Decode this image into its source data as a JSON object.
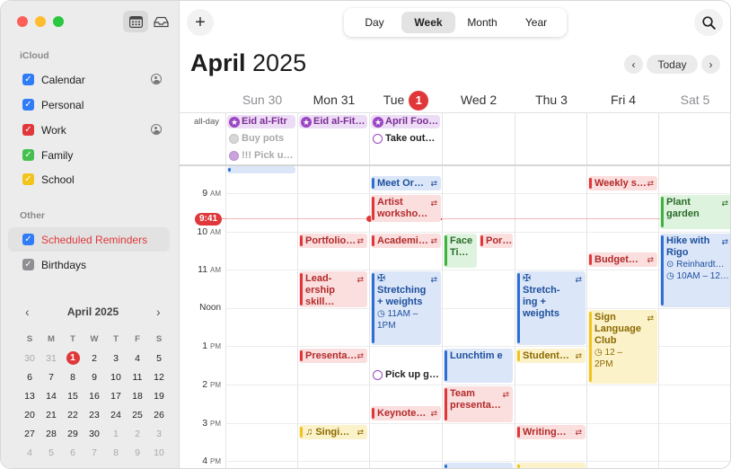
{
  "sidebar": {
    "icloud_header": "iCloud",
    "other_header": "Other",
    "calendars": [
      {
        "label": "Calendar",
        "color": "#2f7cf6",
        "shared": true
      },
      {
        "label": "Personal",
        "color": "#2f7cf6",
        "shared": false
      },
      {
        "label": "Work",
        "color": "#e0383a",
        "shared": true
      },
      {
        "label": "Family",
        "color": "#43c04d",
        "shared": false
      },
      {
        "label": "School",
        "color": "#f2c31b",
        "shared": false
      }
    ],
    "other": [
      {
        "label": "Scheduled Reminders",
        "color": "#2f7cf6"
      },
      {
        "label": "Birthdays",
        "color": "#8e8e93"
      }
    ]
  },
  "mini_calendar": {
    "title": "April 2025",
    "weekdays": [
      "S",
      "M",
      "T",
      "W",
      "T",
      "F",
      "S"
    ],
    "weeks": [
      [
        "30",
        "31",
        "1",
        "2",
        "3",
        "4",
        "5"
      ],
      [
        "6",
        "7",
        "8",
        "9",
        "10",
        "11",
        "12"
      ],
      [
        "13",
        "14",
        "15",
        "16",
        "17",
        "18",
        "19"
      ],
      [
        "20",
        "21",
        "22",
        "23",
        "24",
        "25",
        "26"
      ],
      [
        "27",
        "28",
        "29",
        "30",
        "1",
        "2",
        "3"
      ],
      [
        "4",
        "5",
        "6",
        "7",
        "8",
        "9",
        "10"
      ]
    ],
    "today": "1"
  },
  "toolbar": {
    "add": "+",
    "views": [
      "Day",
      "Week",
      "Month",
      "Year"
    ],
    "active_view": "Week"
  },
  "header": {
    "month": "April",
    "year": "2025",
    "today_button": "Today",
    "prev": "‹",
    "next": "›"
  },
  "days": [
    {
      "label": "Sun 30",
      "dim": true
    },
    {
      "label": "Mon 31",
      "dim": false
    },
    {
      "label": "Tue",
      "badge": "1",
      "dim": false
    },
    {
      "label": "Wed 2",
      "dim": false
    },
    {
      "label": "Thu 3",
      "dim": false
    },
    {
      "label": "Fri 4",
      "dim": false
    },
    {
      "label": "Sat 5",
      "dim": true
    }
  ],
  "allday_label": "all-day",
  "hours": [
    {
      "num": "9",
      "ampm": "AM"
    },
    {
      "num": "10",
      "ampm": "AM"
    },
    {
      "num": "11",
      "ampm": "AM"
    },
    {
      "num": "Noon",
      "ampm": ""
    },
    {
      "num": "1",
      "ampm": "PM"
    },
    {
      "num": "2",
      "ampm": "PM"
    },
    {
      "num": "3",
      "ampm": "PM"
    },
    {
      "num": "4",
      "ampm": "PM"
    }
  ],
  "current_time": "9:41",
  "allday_events": [
    {
      "title": "Eid al-Fitr",
      "icon": "★"
    },
    {
      "title": "Eid al-Fit…",
      "icon": "★"
    },
    {
      "title": "April Foo…",
      "icon": "★"
    }
  ],
  "reminders": [
    {
      "title": "Buy pots"
    },
    {
      "title": "!!! Pick u…"
    },
    {
      "title": "Take out…"
    },
    {
      "title": "Pick up g…"
    }
  ],
  "events": [
    {
      "title": "Meet Or…",
      "repeat": "⇄"
    },
    {
      "title": "Artist workshо…",
      "repeat": "⇄"
    },
    {
      "title": "Portfolio…",
      "repeat": "⇄"
    },
    {
      "title": "Academi…",
      "repeat": "⇄"
    },
    {
      "title": "Face Ti…"
    },
    {
      "title": "Por…"
    },
    {
      "title": "Lead-ership skill…",
      "repeat": "⇄"
    },
    {
      "title": "Stretching + weights",
      "time": "11AM – 1PM",
      "repeat": "⇄"
    },
    {
      "title": "Stretch-ing + weights",
      "repeat": "⇄"
    },
    {
      "title": "Weekly s…",
      "repeat": "⇄"
    },
    {
      "title": "Plant garden",
      "repeat": "⇄"
    },
    {
      "title": "Budget…",
      "repeat": "⇄"
    },
    {
      "title": "Hike with Rigo",
      "location": "Reinhardt…",
      "time": "10AM – 12…",
      "repeat": "⇄"
    },
    {
      "title": "Sign Language Club",
      "time": "12 – 2PM",
      "repeat": "⇄"
    },
    {
      "title": "Presenta…",
      "repeat": "⇄"
    },
    {
      "title": "Lunchtim e"
    },
    {
      "title": "Student…",
      "repeat": "⇄"
    },
    {
      "title": "Team presenta…",
      "repeat": "⇄"
    },
    {
      "title": "Keynote…",
      "repeat": "⇄"
    },
    {
      "title": "Singi…",
      "repeat": "⇄"
    },
    {
      "title": "Writing…",
      "repeat": "⇄"
    }
  ]
}
